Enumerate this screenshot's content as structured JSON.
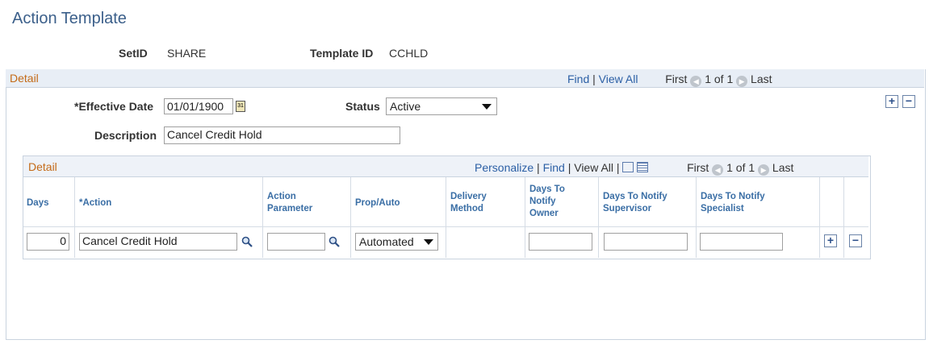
{
  "page": {
    "title": "Action Template"
  },
  "key": {
    "setid_label": "SetID",
    "setid_value": "SHARE",
    "template_label": "Template ID",
    "template_value": "CCHLD"
  },
  "outer": {
    "header": "Detail",
    "find": "Find",
    "sep1": "|",
    "view_all": "View All",
    "first": "First",
    "count": "1 of 1",
    "last": "Last"
  },
  "form": {
    "effdt_label": "*Effective Date",
    "effdt_value": "01/01/1900",
    "status_label": "Status",
    "status_value": "Active",
    "desc_label": "Description",
    "desc_value": "Cancel Credit Hold"
  },
  "grid": {
    "header": "Detail",
    "personalize": "Personalize",
    "sep1": "|",
    "find": "Find",
    "sep2": "|",
    "view_all": "View All",
    "sep3": "|",
    "first": "First",
    "count": "1 of 1",
    "last": "Last",
    "columns": {
      "days": "Days",
      "action": "*Action",
      "param_1": "Action",
      "param_2": "Parameter",
      "prop": "Prop/Auto",
      "deliv_1": "Delivery",
      "deliv_2": "Method",
      "owner_1": "Days To",
      "owner_2": "Notify",
      "owner_3": "Owner",
      "sup_1": "Days To Notify",
      "sup_2": "Supervisor",
      "spec_1": "Days To Notify",
      "spec_2": "Specialist"
    },
    "rows": [
      {
        "days": "0",
        "action": "Cancel Credit Hold",
        "param": "",
        "prop": "Automated",
        "owner": "",
        "supervisor": "",
        "specialist": ""
      }
    ]
  },
  "icons": {
    "plus": "+",
    "minus": "−",
    "prev": "◀",
    "next": "▶",
    "calendar": "31"
  }
}
